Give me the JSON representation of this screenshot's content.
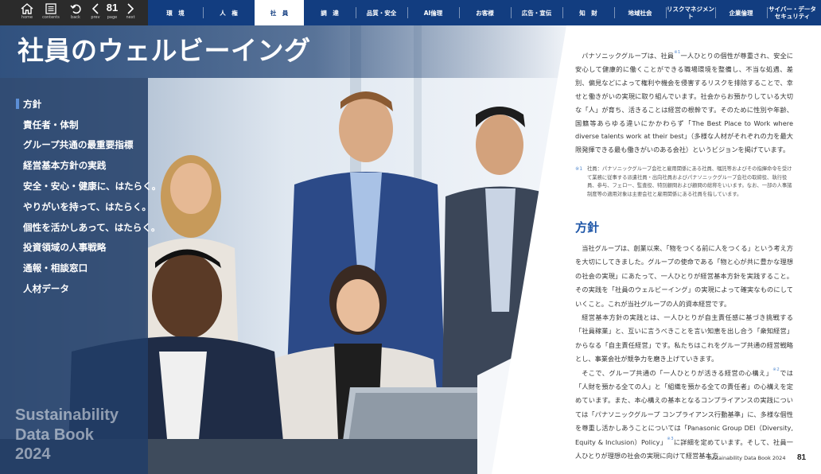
{
  "toolbar": {
    "home_label": "home",
    "contents_label": "contents",
    "back_label": "back",
    "prev_label": "prev",
    "page_number": "81",
    "page_caption": "page",
    "next_label": "next"
  },
  "nav": {
    "tabs": [
      {
        "label": "環　境"
      },
      {
        "label": "人　権"
      },
      {
        "label": "社　員"
      },
      {
        "label": "調　達"
      },
      {
        "label": "品質・安全"
      },
      {
        "label": "AI倫理"
      },
      {
        "label": "お客様"
      },
      {
        "label": "広告・宣伝"
      },
      {
        "label": "知　財"
      },
      {
        "label": "地域社会"
      },
      {
        "label": "リスクマネジメント"
      },
      {
        "label": "企業倫理"
      },
      {
        "label": "サイバー・データ\nセキュリティ"
      }
    ],
    "active_tab": "社　員",
    "accent_color": "#123d80"
  },
  "page": {
    "title": "社員のウェルビーイング"
  },
  "sidenav": {
    "items": [
      {
        "label": "方針",
        "current": true
      },
      {
        "label": "責任者・体制"
      },
      {
        "label": "グループ共通の最重要指標"
      },
      {
        "label": "経営基本方針の実践"
      },
      {
        "label": "安全・安心・健康に、はたらく。"
      },
      {
        "label": "やりがいを持って、はたらく。"
      },
      {
        "label": "個性を活かしあって、はたらく。"
      },
      {
        "label": "投資領域の人事戦略"
      },
      {
        "label": "通報・相談窓口"
      },
      {
        "label": "人材データ"
      }
    ]
  },
  "watermark": {
    "line1": "Sustainability",
    "line2": "Data Book",
    "line3": "2024"
  },
  "content": {
    "intro_a": "パナソニックグループは、社員",
    "intro_sup": "※1",
    "intro_b": "一人ひとりの個性が尊重され、安全に安心して健康的に働くことができる職場環境を整備し、不当な処遇、差別、偏見などによって権利や機会を侵害するリスクを排除することで、幸せと働きがいの実現に取り組んでいます。社会からお預かりしている大切な「人」が育ち、活きることは経営の根幹です。そのために性別や年齢、国籍等あらゆる違いにかかわらず「The Best Place to Work where diverse talents work at their best」（多様な人材がそれぞれの力を最大限発揮できる最も働きがいのある会社）というビジョンを掲げています。",
    "footnote_mark": "※1",
    "footnote_text": "社員：パナソニックグループ会社と雇用関係にある社員、嘱託等およびその指揮命令を受けて業務に従事する派遣社員・出向社員およびパナソニックグループ会社の取締役、執行役員、参与、フェロー、監査役、特別顧問および顧問の総称をいいます。なお、一部の人事諸制度等の適用対象は主要会社と雇用関係にある社員を指しています。",
    "section_heading": "方針",
    "para1": "当社グループは、創業以来、「物をつくる前に人をつくる」という考え方を大切にしてきました。グループの使命である「物と心が共に豊かな理想の社会の実現」にあたって、一人ひとりが経営基本方針を実践すること。その実践を「社員のウェルビーイング」の実現によって確実なものにしていくこと。これが当社グループの人的資本経営です。",
    "para2": "経営基本方針の実践とは、一人ひとりが自主責任感に基づき挑戦する「社員稼業」と、互いに言うべきことを言い知恵を出し合う「衆知経営」からなる「自主責任経営」です。私たちはこれをグループ共通の経営戦略とし、事業会社が競争力を磨き上げていきます。",
    "para3_a": "そこで、グループ共通の「一人ひとりが活きる経営の心構え」",
    "para3_sup1": "※2",
    "para3_b": "では「人財を預かる全ての人」と「組織を預かる全ての責任者」の心構えを定めています。また、本心構えの基本となるコンプライアンスの実践については「パナソニックグループ コンプライアンス行動基準」に、多様な個性を尊重し活かしあうことについては「Panasonic Group DEI（Diversity, Equity & Inclusion）Policy」",
    "para3_sup2": "※3",
    "para3_c": "に詳細を定めています。そして、社員一人ひとりが理想の社会の実現に向けて経営基本方"
  },
  "footer": {
    "book": "Sustainability Data Book 2024",
    "page": "81"
  }
}
